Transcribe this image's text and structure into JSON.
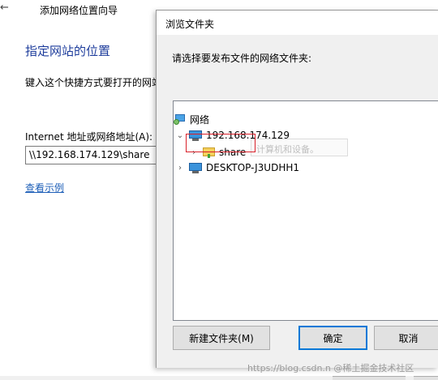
{
  "wizard": {
    "back_glyph": "←",
    "title": "添加网络位置向导",
    "heading": "指定网站的位置",
    "description": "键入这个快捷方式要打开的网站",
    "address_label": "Internet 地址或网络地址(A):",
    "address_value": "\\\\192.168.174.129\\share",
    "example_link": "查看示例"
  },
  "dialog": {
    "title": "浏览文件夹",
    "instruction": "请选择要发布文件的网络文件夹:",
    "tree": {
      "root_label": "网络",
      "host_label": "192.168.174.129",
      "share_label": "share",
      "desktop_label": "DESKTOP-J3UDHH1",
      "tooltip_text": "计算机和设备。"
    },
    "buttons": {
      "new_folder": "新建文件夹(M)",
      "ok": "确定",
      "cancel": "取消"
    }
  },
  "watermark": "https://blog.csdn.n @稀土掘金技术社区",
  "colors": {
    "heading": "#1e3d9c",
    "link": "#1e5fb8",
    "highlight": "#d9202a",
    "primary_border": "#0078d7"
  }
}
